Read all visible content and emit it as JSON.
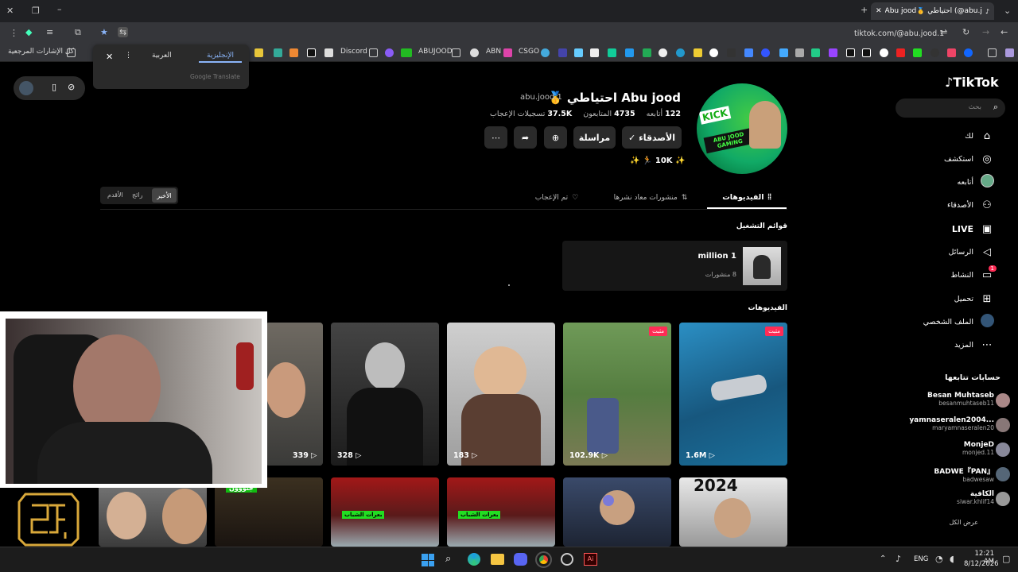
{
  "browser": {
    "tab_title": "Abu jood🥇 احتياطي (@abu.jood.1",
    "url": "tiktok.com/@abu.jood.1",
    "bookmarks": [
      "Discord",
      "ABUJOOD",
      "ABN",
      "CSGO"
    ],
    "all_bookmarks": "كل الإشارات المرجعية"
  },
  "translate_popup": {
    "tab_english": "الإنجليزية",
    "tab_arabic": "العربية",
    "provider": "Google Translate"
  },
  "sidebar": {
    "logo": "TikTok",
    "search_placeholder": "بحث",
    "items": [
      {
        "label": "لك",
        "icon": "home-icon"
      },
      {
        "label": "استكشف",
        "icon": "compass-icon"
      },
      {
        "label": "أتابعه",
        "icon": "avatar-icon"
      },
      {
        "label": "الأصدقاء",
        "icon": "friends-icon"
      },
      {
        "label": "LIVE",
        "icon": "live-icon"
      },
      {
        "label": "الرسائل",
        "icon": "send-icon"
      },
      {
        "label": "النشاط",
        "icon": "activity-icon",
        "badge": "1"
      },
      {
        "label": "تحميل",
        "icon": "upload-icon"
      },
      {
        "label": "الملف الشخصي",
        "icon": "profile-icon"
      },
      {
        "label": "المزيد",
        "icon": "more-icon"
      }
    ],
    "following_title": "حسابات تتابعها",
    "following": [
      {
        "name": "Besan Muhtaseb",
        "handle": "besanmuhtaseb11"
      },
      {
        "name": "yamnaseralen2004...",
        "handle": "maryamnaseralen20"
      },
      {
        "name": "MonjeD",
        "handle": "monjed.11"
      },
      {
        "name": "BADWE『PAN』",
        "handle": "badwesaw"
      },
      {
        "name": "الكافية",
        "handle": "siwar.khlif14"
      }
    ],
    "see_all": "عرض الكل"
  },
  "profile": {
    "name": "Abu jood احتياطي 🥇",
    "handle": "abu.jood.1",
    "following_count": "122",
    "following_label": "أتابعه",
    "followers_count": "4735",
    "followers_label": "المتابعون",
    "likes_count": "37.5K",
    "likes_label": "تسجيلات الإعجاب",
    "friends_btn": "الأصدقاء ✓",
    "message_btn": "مراسلة",
    "bio": "✨ 🏃 10K ✨",
    "avatar_text": "KICK ABU JOOD GAMING"
  },
  "tabs": {
    "videos": "الفيديوهات",
    "reposts": "منشورات معاد نشرها",
    "liked": "تم الإعجاب"
  },
  "sort": {
    "latest": "الأخير",
    "popular": "رائج",
    "oldest": "الأقدم"
  },
  "playlists": {
    "title": "قوائم التشغيل",
    "item_name": "million 1",
    "item_count": "8 منشورات"
  },
  "videos_title": "الفيديوهات",
  "pinned_label": "مثبت",
  "videos": [
    "1.6M",
    "102.9K",
    "183",
    "328",
    "339"
  ],
  "row2_labels": {
    "a": "بعرات الشباب",
    "b": "جنووون",
    "year": "2024"
  },
  "taskbar": {
    "lang": "ENG",
    "time": "12:21 AM",
    "date": "8/12/2026"
  },
  "colors": {
    "accent": "#fe2c55",
    "bg": "#000000"
  }
}
